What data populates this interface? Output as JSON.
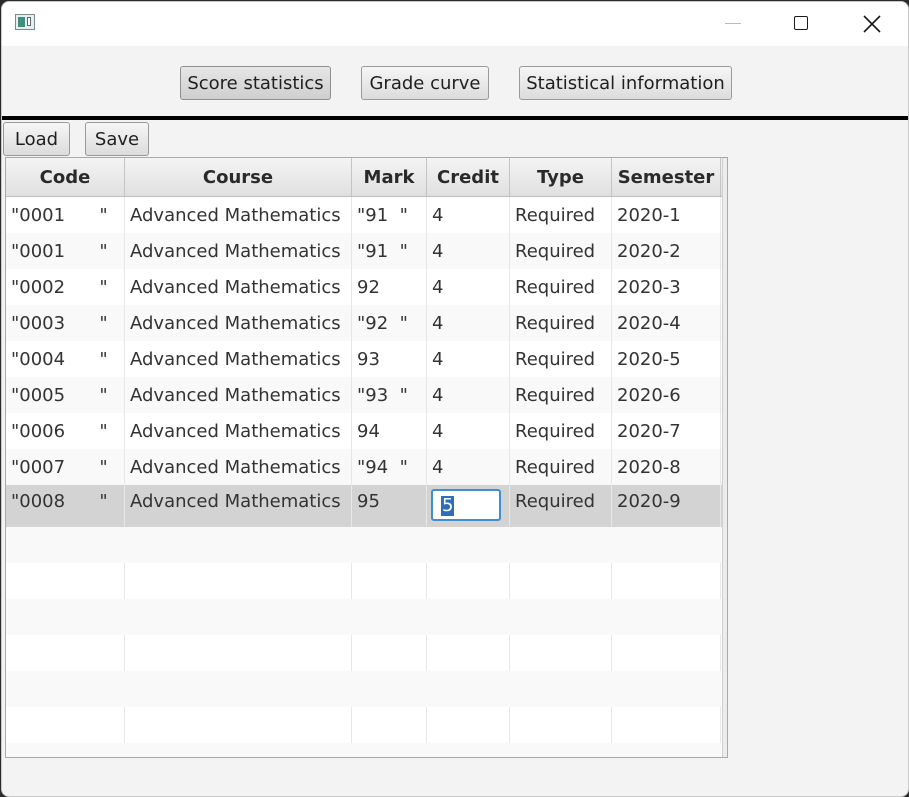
{
  "window": {
    "icon": "app-icon",
    "controls": [
      "minimize-icon",
      "maximize-icon",
      "close-icon"
    ]
  },
  "tabs": [
    {
      "label": "Score statistics",
      "selected": true
    },
    {
      "label": "Grade curve"
    },
    {
      "label": "Statistical information"
    }
  ],
  "toolbar": {
    "load_label": "Load",
    "save_label": "Save"
  },
  "table": {
    "columns": [
      "Code",
      "Course",
      "Mark",
      "Credit",
      "Type",
      "Semester"
    ],
    "rows": [
      [
        "\"0001      \"",
        "Advanced Mathematics",
        "\"91  \"",
        "4",
        "Required",
        "2020-1"
      ],
      [
        "\"0001      \"",
        "Advanced Mathematics",
        "\"91  \"",
        "4",
        "Required",
        "2020-2"
      ],
      [
        "\"0002      \"",
        "Advanced Mathematics",
        "92",
        "4",
        "Required",
        "2020-3"
      ],
      [
        "\"0003      \"",
        "Advanced Mathematics",
        "\"92  \"",
        "4",
        "Required",
        "2020-4"
      ],
      [
        "\"0004      \"",
        "Advanced Mathematics",
        "93",
        "4",
        "Required",
        "2020-5"
      ],
      [
        "\"0005      \"",
        "Advanced Mathematics",
        "\"93  \"",
        "4",
        "Required",
        "2020-6"
      ],
      [
        "\"0006      \"",
        "Advanced Mathematics",
        "94",
        "4",
        "Required",
        "2020-7"
      ],
      [
        "\"0007      \"",
        "Advanced Mathematics",
        "\"94  \"",
        "4",
        "Required",
        "2020-8"
      ],
      [
        "\"0008      \"",
        "Advanced Mathematics",
        "95",
        "5",
        "Required",
        "2020-9"
      ]
    ],
    "selected_row": 8,
    "editing_cell": {
      "row": 8,
      "column": "Credit",
      "value": "5"
    },
    "accent_color": "#2f6db8"
  }
}
